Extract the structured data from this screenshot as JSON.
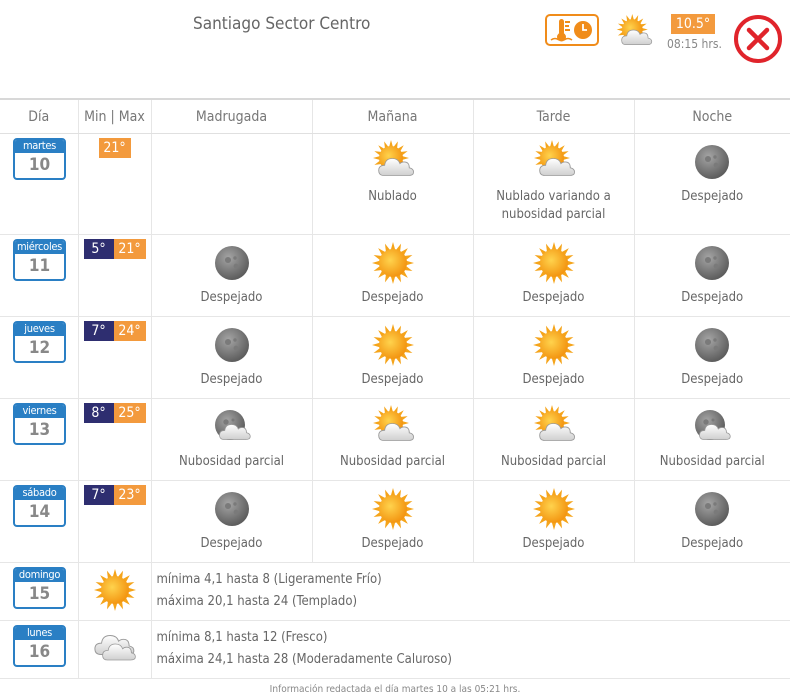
{
  "header": {
    "location": "Santiago Sector Centro",
    "current_temp": "10.5°",
    "current_time": "08:15 hrs.",
    "temp_icon": "thermometer-clock-icon",
    "current_weather_icon": "sun-cloud-icon",
    "close_icon": "close-icon"
  },
  "columns": {
    "day": "Día",
    "minmax": "Min | Max",
    "madrugada": "Madrugada",
    "manana": "Mañana",
    "tarde": "Tarde",
    "noche": "Noche"
  },
  "days": [
    {
      "name": "martes",
      "num": "10",
      "min": "",
      "max": "21°",
      "periods": [
        {
          "icon": "",
          "label": ""
        },
        {
          "icon": "sun-cloud",
          "label": "Nublado"
        },
        {
          "icon": "sun-cloud",
          "label": "Nublado variando a nubosidad parcial"
        },
        {
          "icon": "moon",
          "label": "Despejado"
        }
      ]
    },
    {
      "name": "miércoles",
      "num": "11",
      "min": "5°",
      "max": "21°",
      "periods": [
        {
          "icon": "moon",
          "label": "Despejado"
        },
        {
          "icon": "sun",
          "label": "Despejado"
        },
        {
          "icon": "sun",
          "label": "Despejado"
        },
        {
          "icon": "moon",
          "label": "Despejado"
        }
      ]
    },
    {
      "name": "jueves",
      "num": "12",
      "min": "7°",
      "max": "24°",
      "periods": [
        {
          "icon": "moon",
          "label": "Despejado"
        },
        {
          "icon": "sun",
          "label": "Despejado"
        },
        {
          "icon": "sun",
          "label": "Despejado"
        },
        {
          "icon": "moon",
          "label": "Despejado"
        }
      ]
    },
    {
      "name": "viernes",
      "num": "13",
      "min": "8°",
      "max": "25°",
      "periods": [
        {
          "icon": "moon-cloud",
          "label": "Nubosidad parcial"
        },
        {
          "icon": "sun-cloud",
          "label": "Nubosidad parcial"
        },
        {
          "icon": "sun-cloud",
          "label": "Nubosidad parcial"
        },
        {
          "icon": "moon-cloud",
          "label": "Nubosidad parcial"
        }
      ]
    },
    {
      "name": "sábado",
      "num": "14",
      "min": "7°",
      "max": "23°",
      "periods": [
        {
          "icon": "moon",
          "label": "Despejado"
        },
        {
          "icon": "sun",
          "label": "Despejado"
        },
        {
          "icon": "sun",
          "label": "Despejado"
        },
        {
          "icon": "moon",
          "label": "Despejado"
        }
      ]
    }
  ],
  "extended": [
    {
      "name": "domingo",
      "num": "15",
      "icon": "sun",
      "line1": "mínima 4,1 hasta 8 (Ligeramente Frío)",
      "line2": "máxima 20,1 hasta 24 (Templado)"
    },
    {
      "name": "lunes",
      "num": "16",
      "icon": "cloud",
      "line1": "mínima 8,1 hasta 12 (Fresco)",
      "line2": "máxima 24,1 hasta 28 (Moderadamente Caluroso)"
    }
  ],
  "footer": "Información redactada el día martes 10 a las 05:21 hrs.",
  "colors": {
    "accent_blue": "#2a7fc4",
    "max_orange": "#f39a3d",
    "min_navy": "#2e2e70",
    "close_red": "#e0242b"
  }
}
